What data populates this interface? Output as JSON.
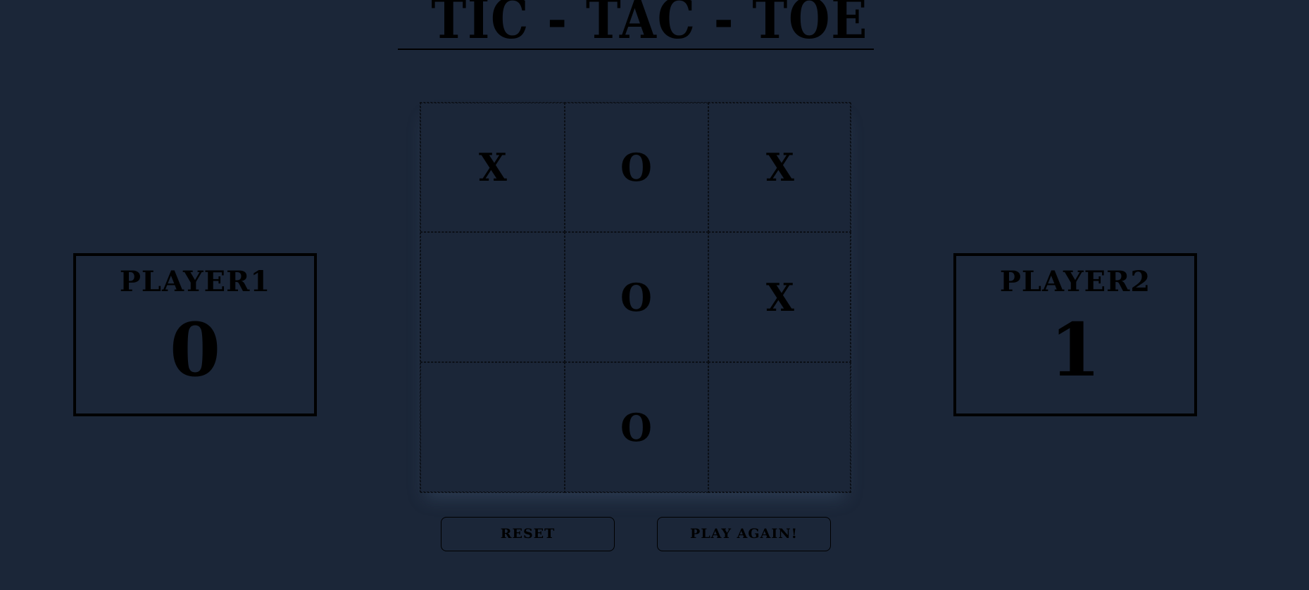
{
  "title": "TIC - TAC - TOE",
  "board": {
    "cells": [
      "X",
      "O",
      "X",
      "",
      "O",
      "X",
      "",
      "O",
      ""
    ]
  },
  "players": [
    {
      "name": "PLAYER1",
      "score": "0"
    },
    {
      "name": "PLAYER2",
      "score": "1"
    }
  ],
  "buttons": {
    "reset_label": "RESET",
    "play_again_label": "PLAY AGAIN!"
  },
  "colors": {
    "background": "#1b2638",
    "ink": "#000000"
  }
}
